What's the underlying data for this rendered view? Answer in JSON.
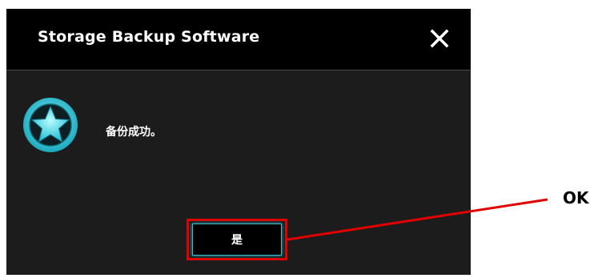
{
  "dialog": {
    "title": "Storage Backup Software",
    "message": "备份成功。",
    "yes_label": "是",
    "icons": {
      "close": "close-icon",
      "status": "star-icon"
    }
  },
  "annotation": {
    "label": "OK",
    "color": "#e00000"
  },
  "colors": {
    "titlebar": "#000000",
    "body": "#1c1c1c",
    "accent": "#3fd0e0"
  }
}
